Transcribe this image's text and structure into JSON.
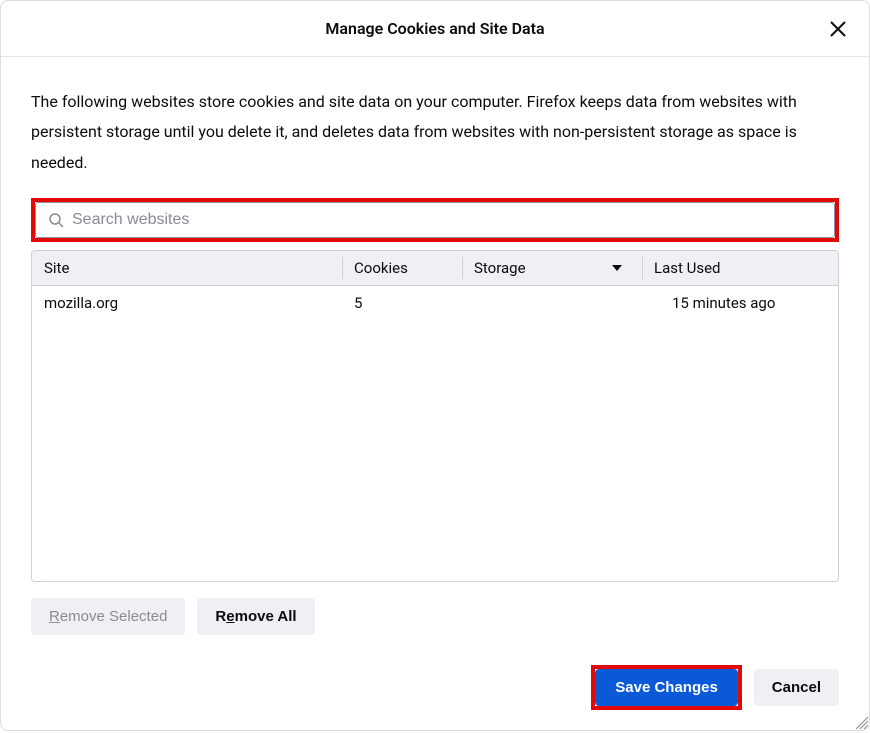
{
  "header": {
    "title": "Manage Cookies and Site Data"
  },
  "description": "The following websites store cookies and site data on your computer. Firefox keeps data from websites with persistent storage until you delete it, and deletes data from websites with non-persistent storage as space is needed.",
  "search": {
    "placeholder": "Search websites"
  },
  "table": {
    "columns": {
      "site": "Site",
      "cookies": "Cookies",
      "storage": "Storage",
      "lastused": "Last Used"
    },
    "rows": [
      {
        "site": "mozilla.org",
        "cookies": "5",
        "storage": "",
        "lastused": "15 minutes ago"
      }
    ]
  },
  "actions": {
    "remove_selected": "Remove Selected",
    "remove_all": "Remove All"
  },
  "footer": {
    "save": "Save Changes",
    "cancel": "Cancel"
  }
}
